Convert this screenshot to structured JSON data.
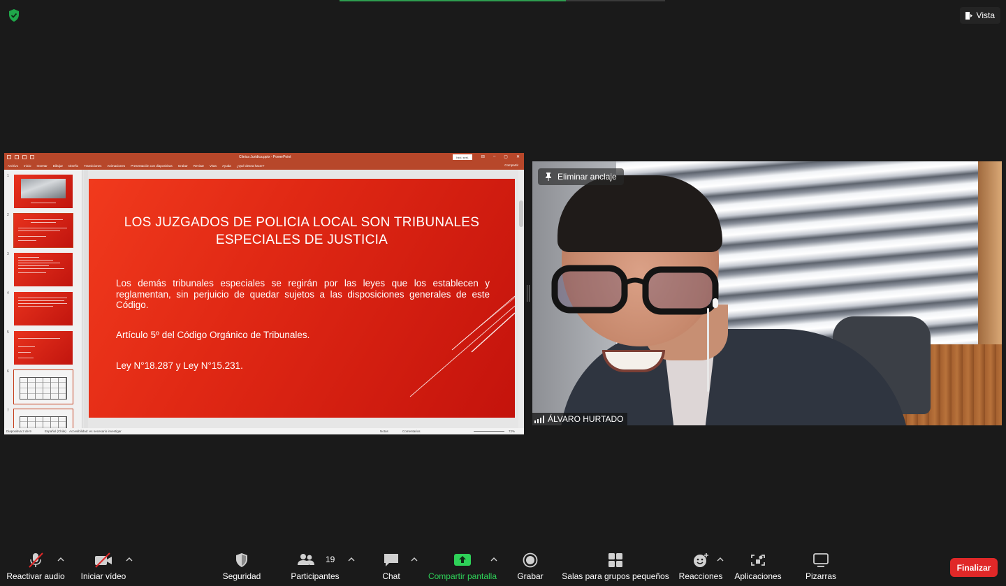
{
  "top": {
    "view_label": "Vista"
  },
  "share": {
    "window_title": "Clinica Juridica.pptx - PowerPoint",
    "user_badge": "Inici. sesi.",
    "menu": [
      "Archivo",
      "Inicio",
      "Insertar",
      "Dibujar",
      "Diseño",
      "Transiciones",
      "Animaciones",
      "Presentación con diapositivas",
      "Grabar",
      "Revisar",
      "Vista",
      "Ayuda",
      "¿Qué desea hacer?"
    ],
    "share_label": "Compartir",
    "thumb_numbers": [
      "1",
      "2",
      "3",
      "4",
      "5",
      "6",
      "7"
    ],
    "slide": {
      "title": "LOS JUZGADOS DE POLICIA LOCAL SON TRIBUNALES ESPECIALES DE JUSTICIA",
      "paragraph": "Los demás tribunales especiales se regirán por las leyes que los establecen y reglamentan, sin perjuicio de quedar sujetos a las disposiciones generales de este Código.",
      "article": "Artículo 5º del Código Orgánico de Tribunales.",
      "laws": "Ley N°18.287 y Ley N°15.231."
    },
    "status": {
      "slide_count": "Diapositiva 2 de 9",
      "language": "Español (Chile)",
      "accessibility": "Accesibilidad: es necesario investigar",
      "notes": "Notas",
      "comments": "Comentarios",
      "zoom": "72%"
    }
  },
  "video": {
    "unpin_label": "Eliminar anclaje",
    "participant_name": "ÁLVARO HURTADO"
  },
  "toolbar": {
    "audio_label": "Reactivar audio",
    "video_label": "Iniciar vídeo",
    "security_label": "Seguridad",
    "participants_label": "Participantes",
    "participants_count": "19",
    "chat_label": "Chat",
    "share_label": "Compartir pantalla",
    "record_label": "Grabar",
    "breakout_label": "Salas para grupos pequeños",
    "reactions_label": "Reacciones",
    "apps_label": "Aplicaciones",
    "whiteboards_label": "Pizarras",
    "end_label": "Finalizar"
  },
  "colors": {
    "accent_green": "#2ed158",
    "end_red": "#e02828",
    "ppt_orange": "#b7472a",
    "slide_red": "#e02814"
  },
  "icons": [
    "shield-check-icon",
    "view-icon",
    "pin-icon",
    "signal-icon",
    "mic-muted-icon",
    "video-off-icon",
    "shield-icon",
    "participants-icon",
    "chat-icon",
    "share-screen-icon",
    "record-icon",
    "breakout-rooms-icon",
    "reactions-icon",
    "apps-icon",
    "whiteboard-icon",
    "chevron-up-icon"
  ]
}
